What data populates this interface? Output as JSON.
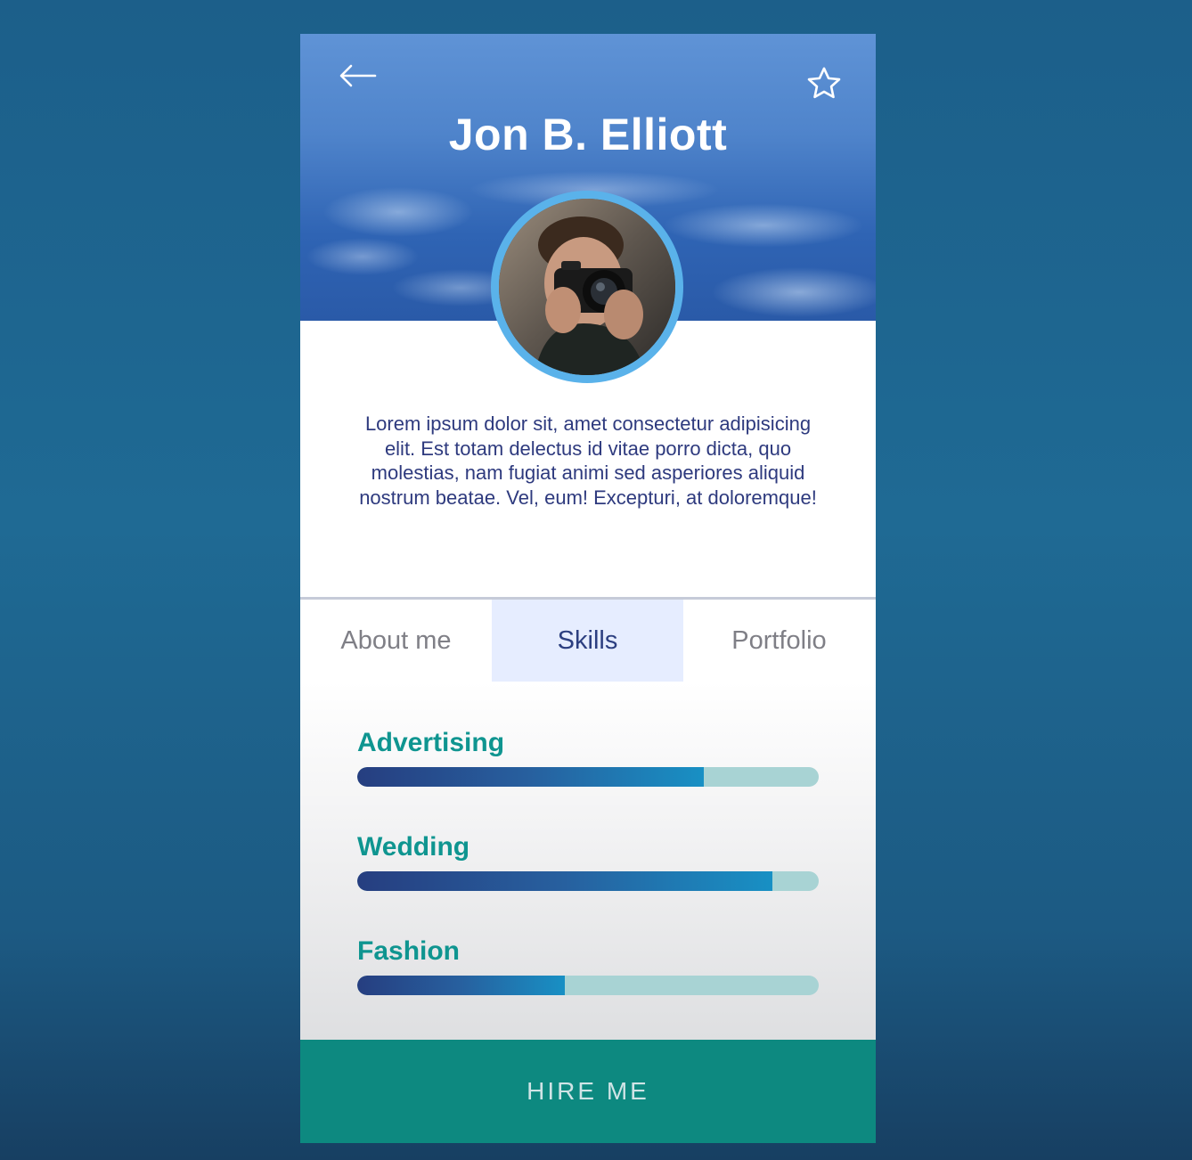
{
  "profile": {
    "name": "Jon B. Elliott",
    "bio": "Lorem ipsum dolor sit, amet consectetur adipisicing elit. Est totam delectus id vitae porro dicta, quo molestias, nam fugiat animi sed asperiores aliquid nostrum beatae. Vel, eum! Excepturi, at doloremque!"
  },
  "header": {
    "back_icon": "arrow-left-icon",
    "favorite_icon": "star-outline-icon"
  },
  "tabs": [
    {
      "label": "About me",
      "active": false
    },
    {
      "label": "Skills",
      "active": true
    },
    {
      "label": "Portfolio",
      "active": false
    }
  ],
  "skills": [
    {
      "name": "Advertising",
      "level": 0.75
    },
    {
      "name": "Wedding",
      "level": 0.9
    },
    {
      "name": "Fashion",
      "level": 0.45
    }
  ],
  "cta": {
    "label": "HIRE ME"
  },
  "colors": {
    "background": "#1e6690",
    "hero_blue": "#4f84cb",
    "avatar_ring": "#5ab2ea",
    "bio_text": "#2e3a7e",
    "tab_active_bg": "#e6edff",
    "skill_label": "#0f9590",
    "bar_track": "#a8d3d4",
    "bar_fill_start": "#263e80",
    "bar_fill_end": "#1890c4",
    "cta_bg": "#0d8980"
  }
}
